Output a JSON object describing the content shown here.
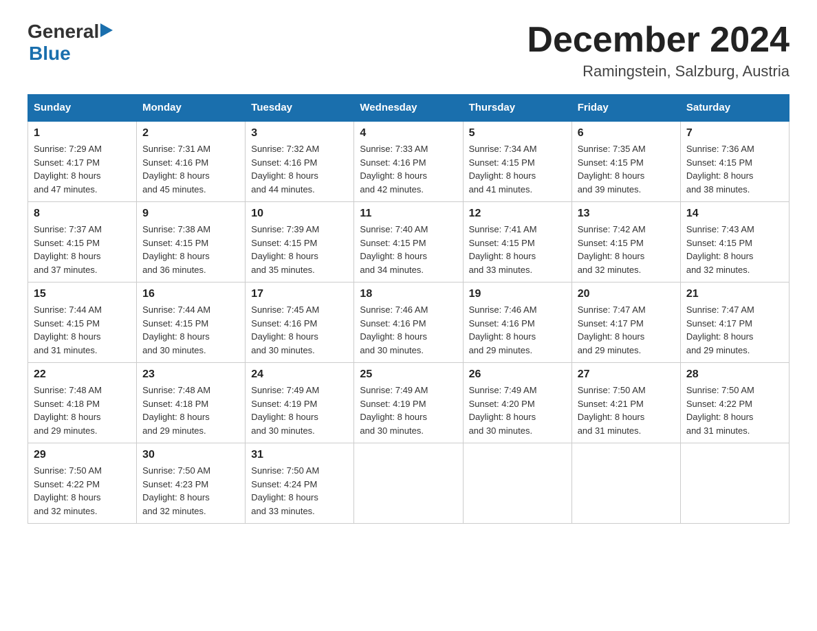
{
  "logo": {
    "general": "General",
    "blue": "Blue"
  },
  "title": "December 2024",
  "location": "Ramingstein, Salzburg, Austria",
  "weekdays": [
    "Sunday",
    "Monday",
    "Tuesday",
    "Wednesday",
    "Thursday",
    "Friday",
    "Saturday"
  ],
  "weeks": [
    [
      {
        "day": "1",
        "sunrise": "7:29 AM",
        "sunset": "4:17 PM",
        "daylight": "8 hours and 47 minutes."
      },
      {
        "day": "2",
        "sunrise": "7:31 AM",
        "sunset": "4:16 PM",
        "daylight": "8 hours and 45 minutes."
      },
      {
        "day": "3",
        "sunrise": "7:32 AM",
        "sunset": "4:16 PM",
        "daylight": "8 hours and 44 minutes."
      },
      {
        "day": "4",
        "sunrise": "7:33 AM",
        "sunset": "4:16 PM",
        "daylight": "8 hours and 42 minutes."
      },
      {
        "day": "5",
        "sunrise": "7:34 AM",
        "sunset": "4:15 PM",
        "daylight": "8 hours and 41 minutes."
      },
      {
        "day": "6",
        "sunrise": "7:35 AM",
        "sunset": "4:15 PM",
        "daylight": "8 hours and 39 minutes."
      },
      {
        "day": "7",
        "sunrise": "7:36 AM",
        "sunset": "4:15 PM",
        "daylight": "8 hours and 38 minutes."
      }
    ],
    [
      {
        "day": "8",
        "sunrise": "7:37 AM",
        "sunset": "4:15 PM",
        "daylight": "8 hours and 37 minutes."
      },
      {
        "day": "9",
        "sunrise": "7:38 AM",
        "sunset": "4:15 PM",
        "daylight": "8 hours and 36 minutes."
      },
      {
        "day": "10",
        "sunrise": "7:39 AM",
        "sunset": "4:15 PM",
        "daylight": "8 hours and 35 minutes."
      },
      {
        "day": "11",
        "sunrise": "7:40 AM",
        "sunset": "4:15 PM",
        "daylight": "8 hours and 34 minutes."
      },
      {
        "day": "12",
        "sunrise": "7:41 AM",
        "sunset": "4:15 PM",
        "daylight": "8 hours and 33 minutes."
      },
      {
        "day": "13",
        "sunrise": "7:42 AM",
        "sunset": "4:15 PM",
        "daylight": "8 hours and 32 minutes."
      },
      {
        "day": "14",
        "sunrise": "7:43 AM",
        "sunset": "4:15 PM",
        "daylight": "8 hours and 32 minutes."
      }
    ],
    [
      {
        "day": "15",
        "sunrise": "7:44 AM",
        "sunset": "4:15 PM",
        "daylight": "8 hours and 31 minutes."
      },
      {
        "day": "16",
        "sunrise": "7:44 AM",
        "sunset": "4:15 PM",
        "daylight": "8 hours and 30 minutes."
      },
      {
        "day": "17",
        "sunrise": "7:45 AM",
        "sunset": "4:16 PM",
        "daylight": "8 hours and 30 minutes."
      },
      {
        "day": "18",
        "sunrise": "7:46 AM",
        "sunset": "4:16 PM",
        "daylight": "8 hours and 30 minutes."
      },
      {
        "day": "19",
        "sunrise": "7:46 AM",
        "sunset": "4:16 PM",
        "daylight": "8 hours and 29 minutes."
      },
      {
        "day": "20",
        "sunrise": "7:47 AM",
        "sunset": "4:17 PM",
        "daylight": "8 hours and 29 minutes."
      },
      {
        "day": "21",
        "sunrise": "7:47 AM",
        "sunset": "4:17 PM",
        "daylight": "8 hours and 29 minutes."
      }
    ],
    [
      {
        "day": "22",
        "sunrise": "7:48 AM",
        "sunset": "4:18 PM",
        "daylight": "8 hours and 29 minutes."
      },
      {
        "day": "23",
        "sunrise": "7:48 AM",
        "sunset": "4:18 PM",
        "daylight": "8 hours and 29 minutes."
      },
      {
        "day": "24",
        "sunrise": "7:49 AM",
        "sunset": "4:19 PM",
        "daylight": "8 hours and 30 minutes."
      },
      {
        "day": "25",
        "sunrise": "7:49 AM",
        "sunset": "4:19 PM",
        "daylight": "8 hours and 30 minutes."
      },
      {
        "day": "26",
        "sunrise": "7:49 AM",
        "sunset": "4:20 PM",
        "daylight": "8 hours and 30 minutes."
      },
      {
        "day": "27",
        "sunrise": "7:50 AM",
        "sunset": "4:21 PM",
        "daylight": "8 hours and 31 minutes."
      },
      {
        "day": "28",
        "sunrise": "7:50 AM",
        "sunset": "4:22 PM",
        "daylight": "8 hours and 31 minutes."
      }
    ],
    [
      {
        "day": "29",
        "sunrise": "7:50 AM",
        "sunset": "4:22 PM",
        "daylight": "8 hours and 32 minutes."
      },
      {
        "day": "30",
        "sunrise": "7:50 AM",
        "sunset": "4:23 PM",
        "daylight": "8 hours and 32 minutes."
      },
      {
        "day": "31",
        "sunrise": "7:50 AM",
        "sunset": "4:24 PM",
        "daylight": "8 hours and 33 minutes."
      },
      null,
      null,
      null,
      null
    ]
  ],
  "labels": {
    "sunrise": "Sunrise:",
    "sunset": "Sunset:",
    "daylight": "Daylight:"
  }
}
